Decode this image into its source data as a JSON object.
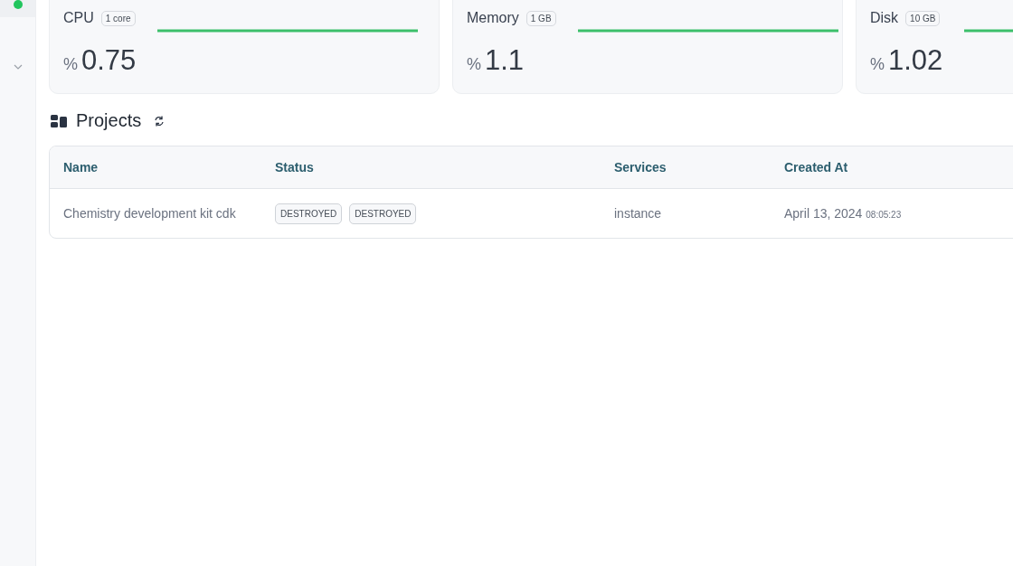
{
  "metrics": [
    {
      "title": "CPU",
      "badge": "1 core",
      "unit": "%",
      "value": "0.75"
    },
    {
      "title": "Memory",
      "badge": "1 GB",
      "unit": "%",
      "value": "1.1"
    },
    {
      "title": "Disk",
      "badge": "10 GB",
      "unit": "%",
      "value": "1.02"
    }
  ],
  "projects": {
    "title": "Projects",
    "table": {
      "columns": [
        "Name",
        "Status",
        "Services",
        "Created At"
      ],
      "rows": [
        {
          "name": "Chemistry development kit cdk",
          "statuses": [
            "DESTROYED",
            "DESTROYED"
          ],
          "services": "instance",
          "date": "April 13, 2024",
          "time": "08:05:23"
        }
      ]
    }
  }
}
